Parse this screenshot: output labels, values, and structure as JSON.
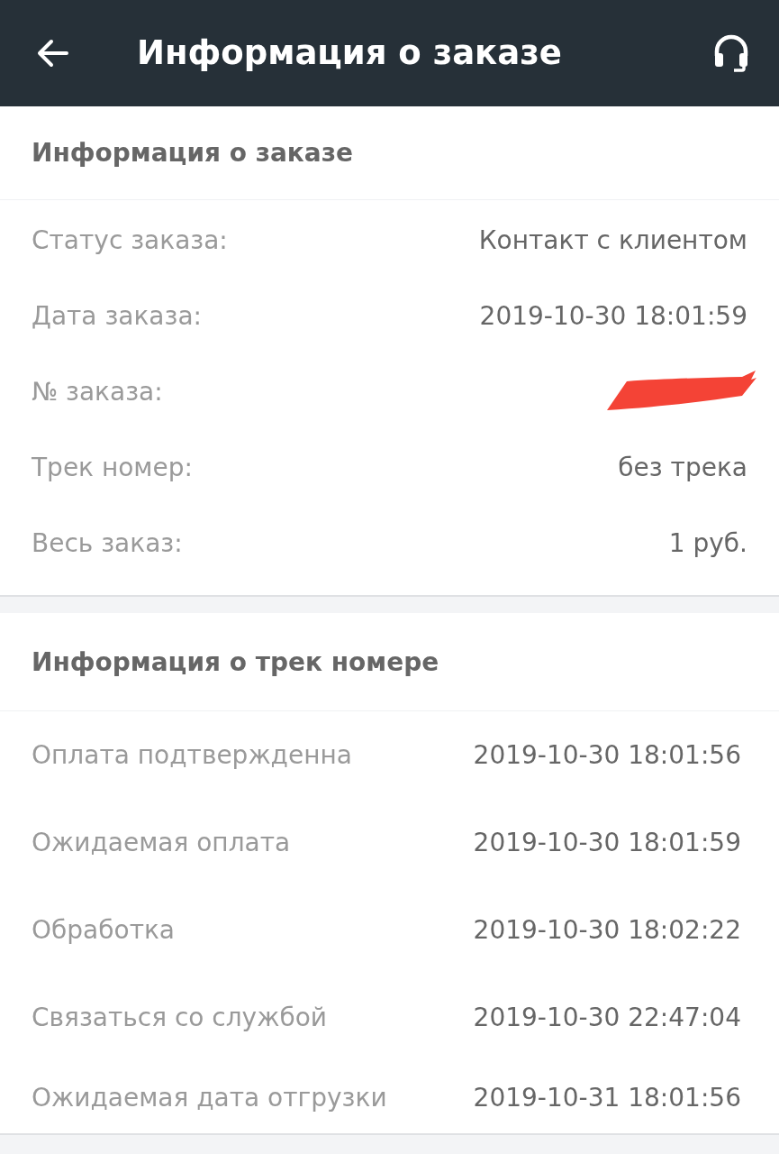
{
  "app_bar": {
    "title": "Информация о заказе"
  },
  "order_info": {
    "title": "Информация о заказе",
    "rows": [
      {
        "label": "Статус заказа:",
        "value": "Контакт с клиентом",
        "redacted": false
      },
      {
        "label": "Дата заказа:",
        "value": "2019-10-30 18:01:59",
        "redacted": false
      },
      {
        "label": "№ заказа:",
        "redacted": true
      },
      {
        "label": "Трек номер:",
        "value": "без трека",
        "redacted": false
      },
      {
        "label": "Весь заказ:",
        "value": "1 руб.",
        "redacted": false
      }
    ]
  },
  "tracking_info": {
    "title": "Информация о трек номере",
    "events": [
      {
        "label": "Оплата подтвержденна",
        "time": "2019-10-30 18:01:56"
      },
      {
        "label": "Ожидаемая оплата",
        "time": "2019-10-30 18:01:59"
      },
      {
        "label": "Обработка",
        "time": "2019-10-30 18:02:22"
      },
      {
        "label": "Связаться со службой",
        "time": "2019-10-30 22:47:04"
      },
      {
        "label": "Ожидаемая дата отгрузки",
        "time": "2019-10-31 18:01:56"
      }
    ]
  }
}
